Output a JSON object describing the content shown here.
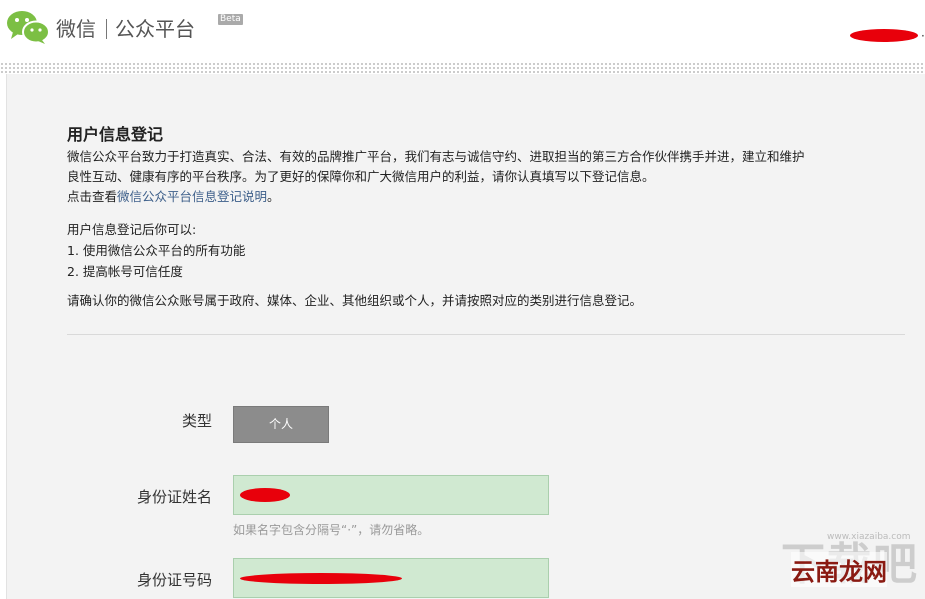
{
  "header": {
    "brand_left": "微信",
    "brand_right": "公众平台",
    "beta": "Beta",
    "account_suffix": "·"
  },
  "content": {
    "title": "用户信息登记",
    "desc_line1": "微信公众平台致力于打造真实、合法、有效的品牌推广平台，我们有志与诚信守约、进取担当的第三方合作伙伴携手并进，建立和维护",
    "desc_line2": "良性互动、健康有序的平台秩序。为了更好的保障你和广大微信用户的利益，请你认真填写以下登记信息。",
    "desc_line3_prefix": "点击查看",
    "desc_link": "微信公众平台信息登记说明",
    "desc_line3_suffix": "。",
    "can_heading": "用户信息登记后你可以:",
    "can_items": [
      "1. 使用微信公众平台的所有功能",
      "2. 提高帐号可信任度"
    ],
    "confirm": "请确认你的微信公众账号属于政府、媒体、企业、其他组织或个人，并请按照对应的类别进行信息登记。"
  },
  "form": {
    "type_label": "类型",
    "type_value": "个人",
    "name_label": "身份证姓名",
    "name_hint": "如果名字包含分隔号“·”，请勿省略。",
    "id_label": "身份证号码"
  },
  "watermark": {
    "ghost": "下载吧",
    "main": "云南龙网",
    "url": "www.xiazaiba.com"
  },
  "colors": {
    "accent_link": "#3d5f8a",
    "field_bg": "#d0e9d1",
    "type_btn": "#8c8c8c",
    "redaction": "#e8000b"
  },
  "icons": {
    "logo": "wechat-logo-icon"
  }
}
